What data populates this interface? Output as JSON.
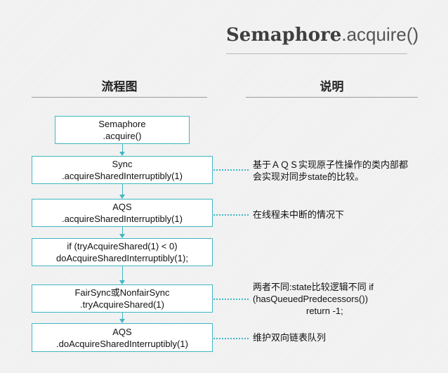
{
  "title": {
    "bold": "Semaphore",
    "light": ".acquire()"
  },
  "columns": {
    "flow": "流程图",
    "notes": "说明"
  },
  "boxes": [
    {
      "line1": "Semaphore",
      "line2": ".acquire()"
    },
    {
      "line1": "Sync",
      "line2": ".acquireSharedInterruptibly(1)"
    },
    {
      "line1": "AQS",
      "line2": ".acquireSharedInterruptibly(1)"
    },
    {
      "line1": "if (tryAcquireShared(1) < 0)",
      "line2": "doAcquireSharedInterruptibly(1);"
    },
    {
      "line1": "FairSync或NonfairSync",
      "line2": ".tryAcquireShared(1)"
    },
    {
      "line1": "AQS",
      "line2": ".doAcquireSharedInterruptibly(1)"
    }
  ],
  "notes": {
    "sync": {
      "line1": "基于ＡＱＳ实现原子性操作的类内部都",
      "line2": "会实现对同步state的比较。"
    },
    "aqs": {
      "line1": "在线程未中断的情况下"
    },
    "fair": {
      "line1": "两者不同:state比较逻辑不同     if",
      "line2": "(hasQueuedPredecessors())",
      "line3": "return -1;"
    },
    "doacq": {
      "line1": "维护双向链表队列"
    }
  },
  "colors": {
    "accent": "#3fb7c4",
    "background": "#f0f0f0"
  }
}
